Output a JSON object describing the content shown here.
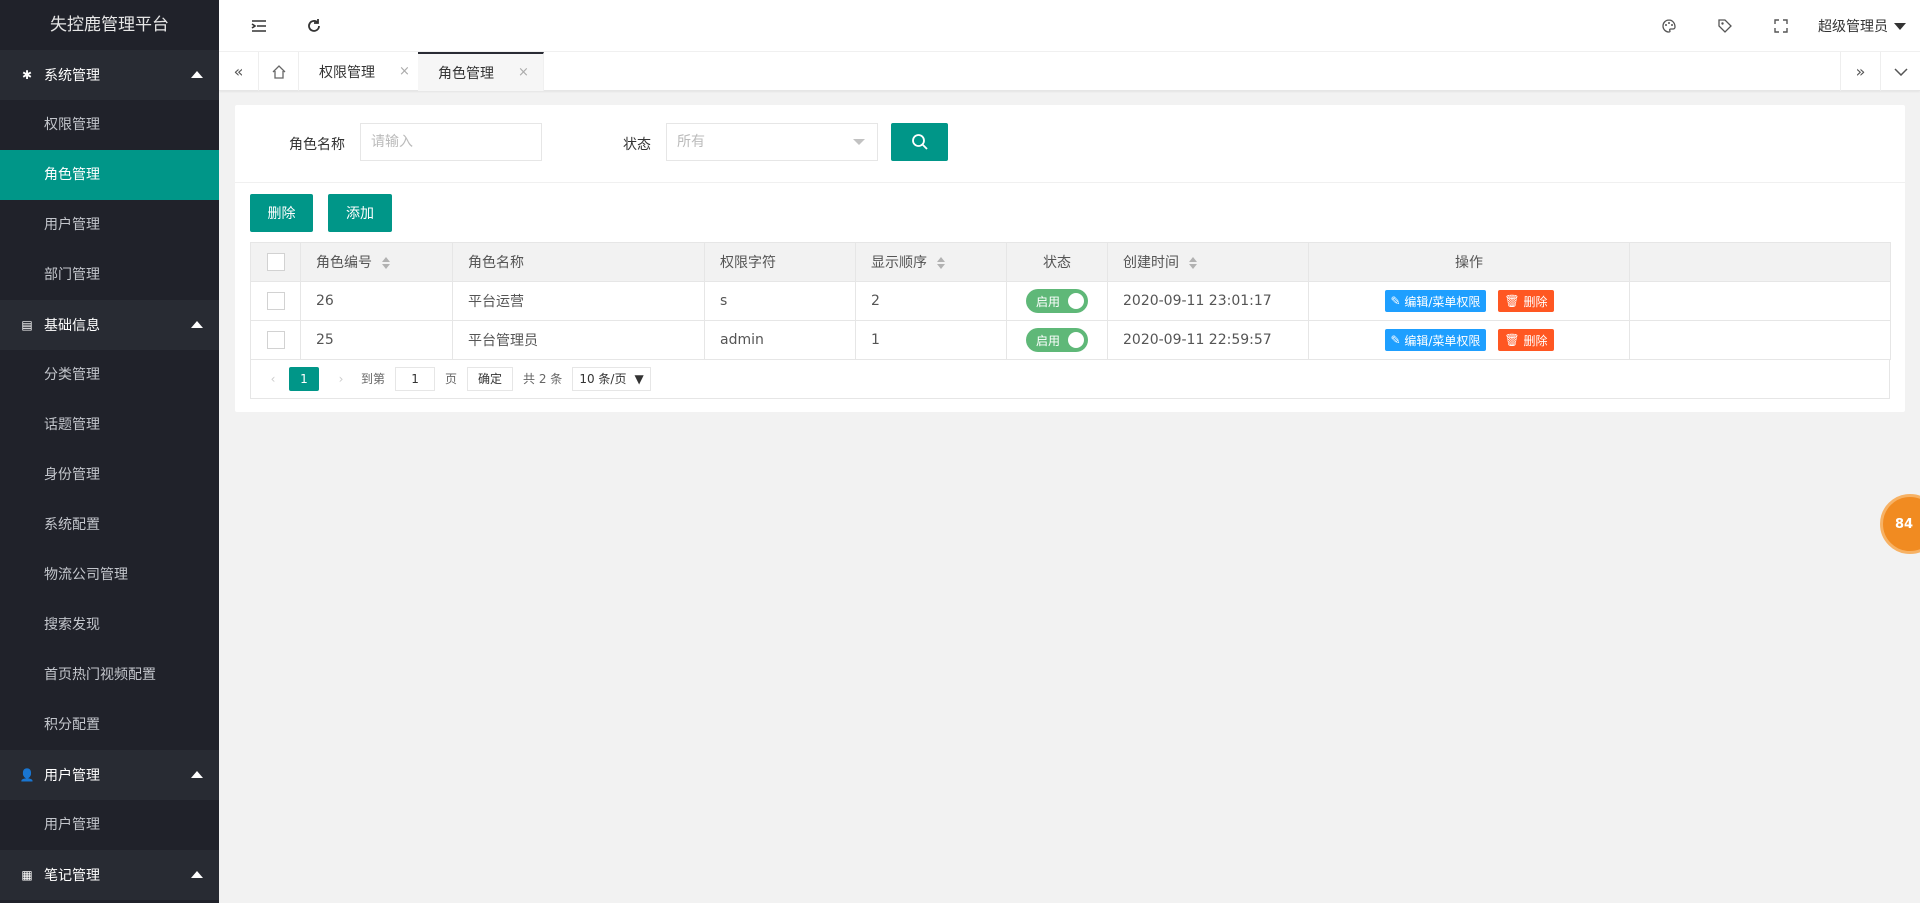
{
  "app": {
    "title": "失控鹿管理平台"
  },
  "sidebar": {
    "groups": [
      {
        "label": "系统管理",
        "icon": "gear-icon"
      },
      {
        "label": "基础信息",
        "icon": "document-icon"
      },
      {
        "label": "用户管理",
        "icon": "user-icon"
      },
      {
        "label": "笔记管理",
        "icon": "note-icon"
      }
    ],
    "items": [
      "权限管理",
      "角色管理",
      "用户管理",
      "部门管理",
      "分类管理",
      "话题管理",
      "身份管理",
      "系统配置",
      "物流公司管理",
      "搜索发现",
      "首页热门视频配置",
      "积分配置",
      "用户管理"
    ]
  },
  "header": {
    "user": "超级管理员"
  },
  "tabs": [
    {
      "label": "权限管理",
      "close": "×"
    },
    {
      "label": "角色管理",
      "close": "×"
    }
  ],
  "search": {
    "name_label": "角色名称",
    "name_placeholder": "请输入",
    "status_label": "状态",
    "status_value": "所有"
  },
  "actions": {
    "delete": "删除",
    "add": "添加"
  },
  "table": {
    "headers": [
      "角色编号",
      "角色名称",
      "权限字符",
      "显示顺序",
      "状态",
      "创建时间",
      "操作"
    ],
    "rows": [
      {
        "id": "26",
        "name": "平台运营",
        "key": "s",
        "order": "2",
        "status": "启用",
        "created": "2020-09-11 23:01:17",
        "edit": "编辑/菜单权限",
        "del": "删除"
      },
      {
        "id": "25",
        "name": "平台管理员",
        "key": "admin",
        "order": "1",
        "status": "启用",
        "created": "2020-09-11 22:59:57",
        "edit": "编辑/菜单权限",
        "del": "删除"
      }
    ]
  },
  "pager": {
    "current": "1",
    "goto": "到第",
    "page_input": "1",
    "page_unit": "页",
    "confirm": "确定",
    "total": "共 2 条",
    "per_page": "10 条/页"
  },
  "float_badge": "84",
  "colors": {
    "accent": "#009688",
    "sidebar": "#20222a",
    "edit": "#1e9fff",
    "danger": "#ff5722",
    "switch_on": "#5fb878"
  }
}
